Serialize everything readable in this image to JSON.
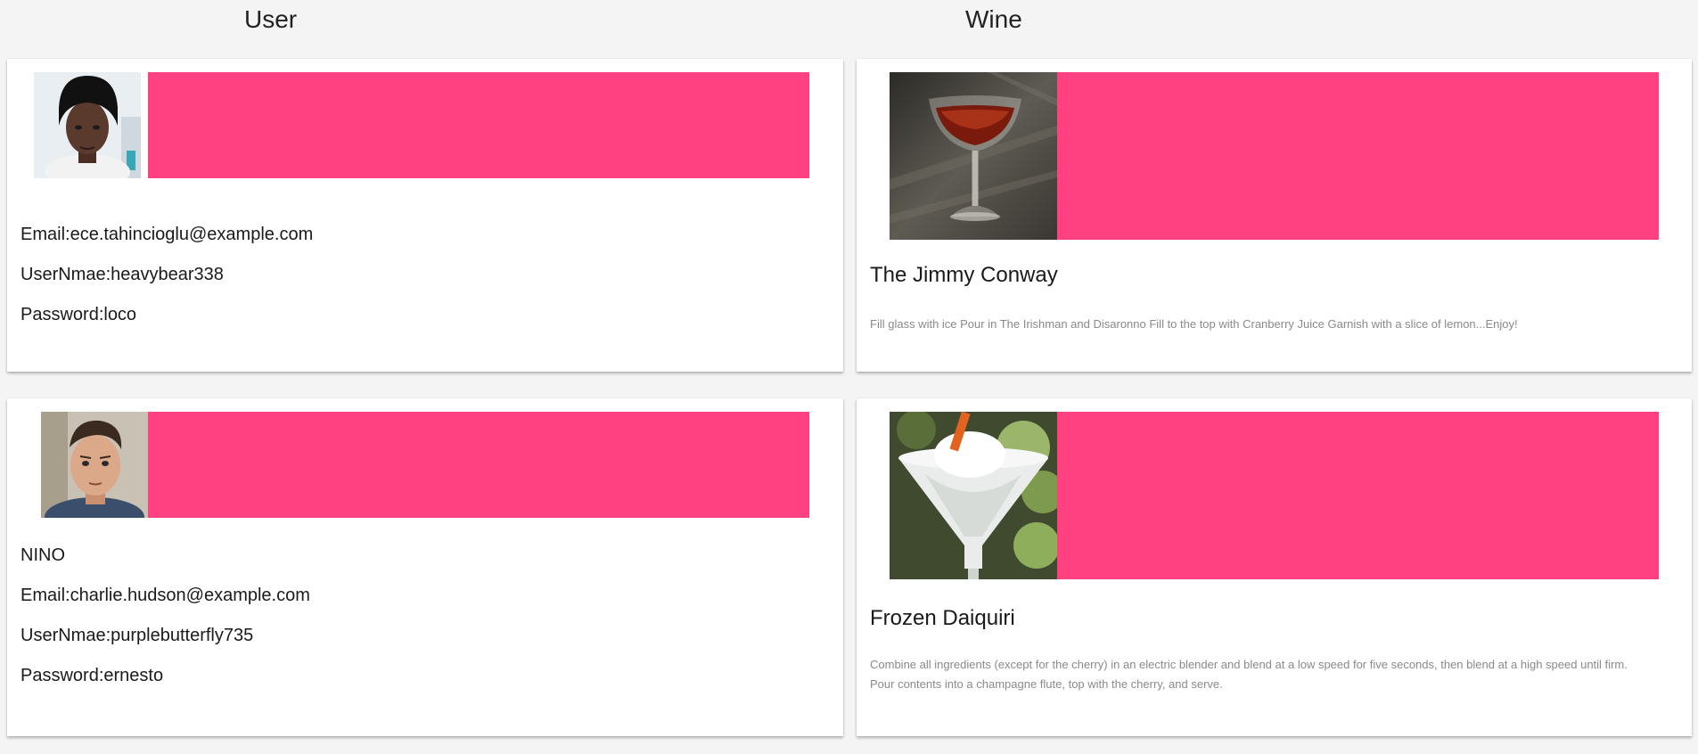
{
  "headers": {
    "user": "User",
    "wine": "Wine"
  },
  "users": [
    {
      "name": "",
      "email": "Email:ece.tahincioglu@example.com",
      "username": "UserNmae:heavybear338",
      "password": "Password:loco",
      "avatar_icon": "user-portrait-woman"
    },
    {
      "name": "NINO",
      "email": "Email:charlie.hudson@example.com",
      "username": "UserNmae:purplebutterfly735",
      "password": "Password:ernesto",
      "avatar_icon": "user-portrait-man"
    }
  ],
  "wines": [
    {
      "name": "The Jimmy Conway",
      "description": "Fill glass with ice Pour in The Irishman and Disaronno Fill to the top with Cranberry Juice Garnish with a slice of lemon...Enjoy!",
      "image_icon": "cocktail-red-coupe"
    },
    {
      "name": "Frozen Daiquiri",
      "description": "Combine all ingredients (except for the cherry) in an electric blender and blend at a low speed for five seconds, then blend at a high speed until firm. Pour contents into a champagne flute, top with the cherry, and serve.",
      "image_icon": "cocktail-frozen-daiquiri"
    }
  ],
  "colors": {
    "accent": "#ff4081",
    "background": "#f4f4f4",
    "card": "#ffffff"
  }
}
